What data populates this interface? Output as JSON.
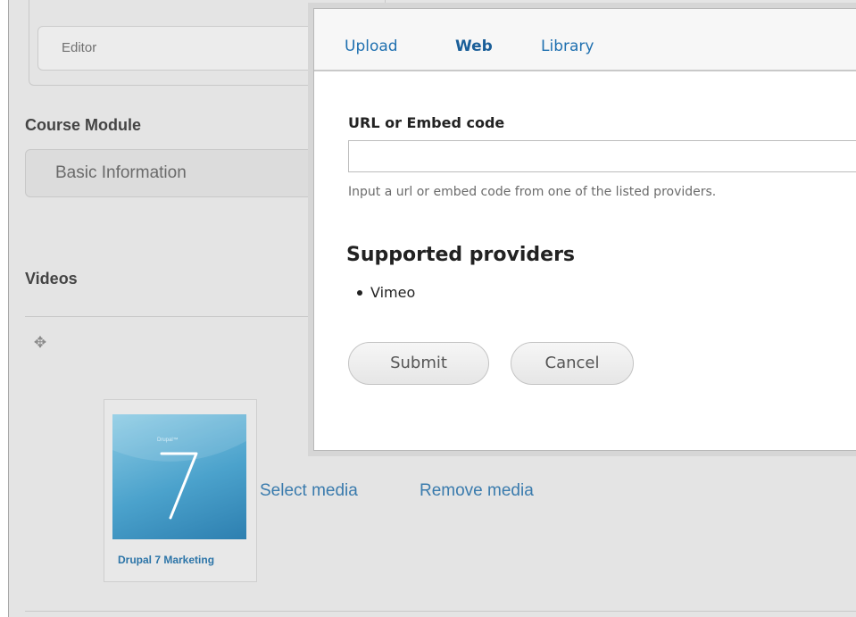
{
  "form": {
    "editor_value": "Editor",
    "course_module_label": "Course Module",
    "course_module_value": "Basic Information",
    "videos_label": "Videos"
  },
  "media_item": {
    "title": "Drupal 7 Marketing",
    "thumbnail_brand": "Drupal™",
    "thumbnail_numeral": "7"
  },
  "media_links": {
    "select": "Select media",
    "remove": "Remove media"
  },
  "dialog": {
    "tabs": [
      {
        "label": "Upload",
        "active": false
      },
      {
        "label": "Web",
        "active": true
      },
      {
        "label": "Library",
        "active": false
      }
    ],
    "field_label": "URL or Embed code",
    "input_value": "",
    "help_text": "Input a url or embed code from one of the listed providers.",
    "providers_heading": "Supported providers",
    "providers": [
      "Vimeo"
    ],
    "submit_label": "Submit",
    "cancel_label": "Cancel"
  },
  "colors": {
    "link": "#3a7bad",
    "tab_link": "#1f70b0",
    "page_bg": "#e4e4e4"
  },
  "icons": {
    "drag": "four-way-arrow-icon"
  }
}
